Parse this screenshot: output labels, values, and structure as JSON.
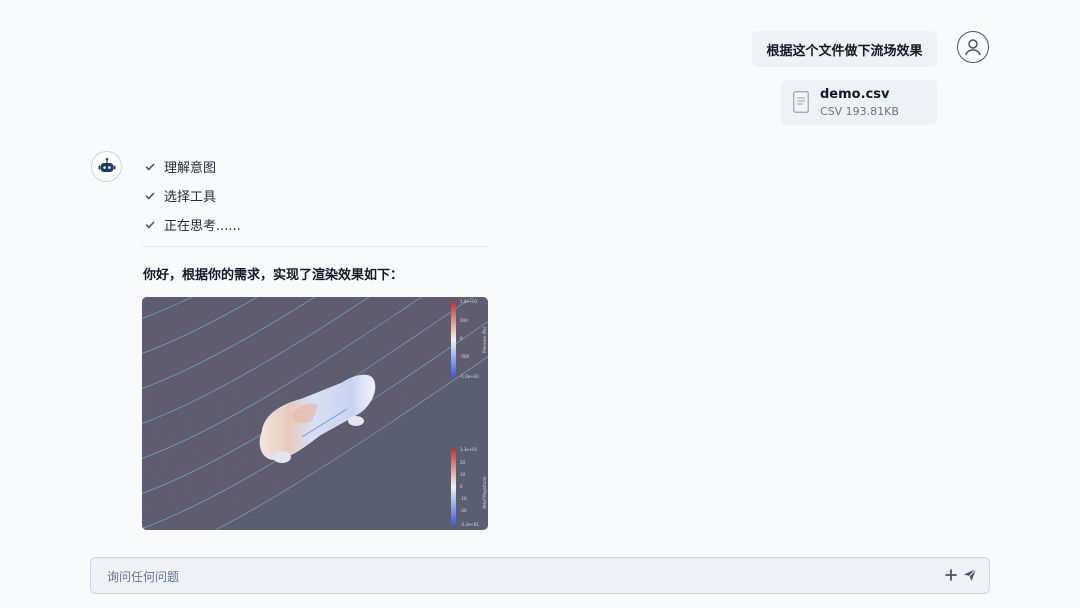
{
  "user_message": {
    "text": "根据这个文件做下流场效果"
  },
  "attachment": {
    "file_name": "demo.csv",
    "file_meta": "CSV 193.81KB",
    "icon": "document-icon"
  },
  "assistant": {
    "steps": [
      {
        "label": "理解意图",
        "icon": "check-icon"
      },
      {
        "label": "选择工具",
        "icon": "check-icon"
      },
      {
        "label": "正在思考......",
        "icon": "check-icon"
      }
    ],
    "response_text": "你好，根据你的需求，实现了渲染效果如下：",
    "render": {
      "pressure_bar": {
        "title": "Pressure (Pa)",
        "ticks": [
          "1.0e+03",
          "500",
          "0",
          "-500",
          "-1.0e+03"
        ]
      },
      "velocity_bar": {
        "title": "Veluf Magnitude",
        "ticks": [
          "3.3e+01",
          "20",
          "10",
          "0",
          "-10",
          "-20",
          "-3.3e+01"
        ]
      }
    }
  },
  "composer": {
    "placeholder": "询问任何问题",
    "add_icon": "plus-icon",
    "send_icon": "send-icon"
  },
  "colors": {
    "background": "#f8fafc",
    "bubble": "#eef1f5",
    "render_bg": "#5a5e70",
    "streamline": "#c0404a"
  }
}
